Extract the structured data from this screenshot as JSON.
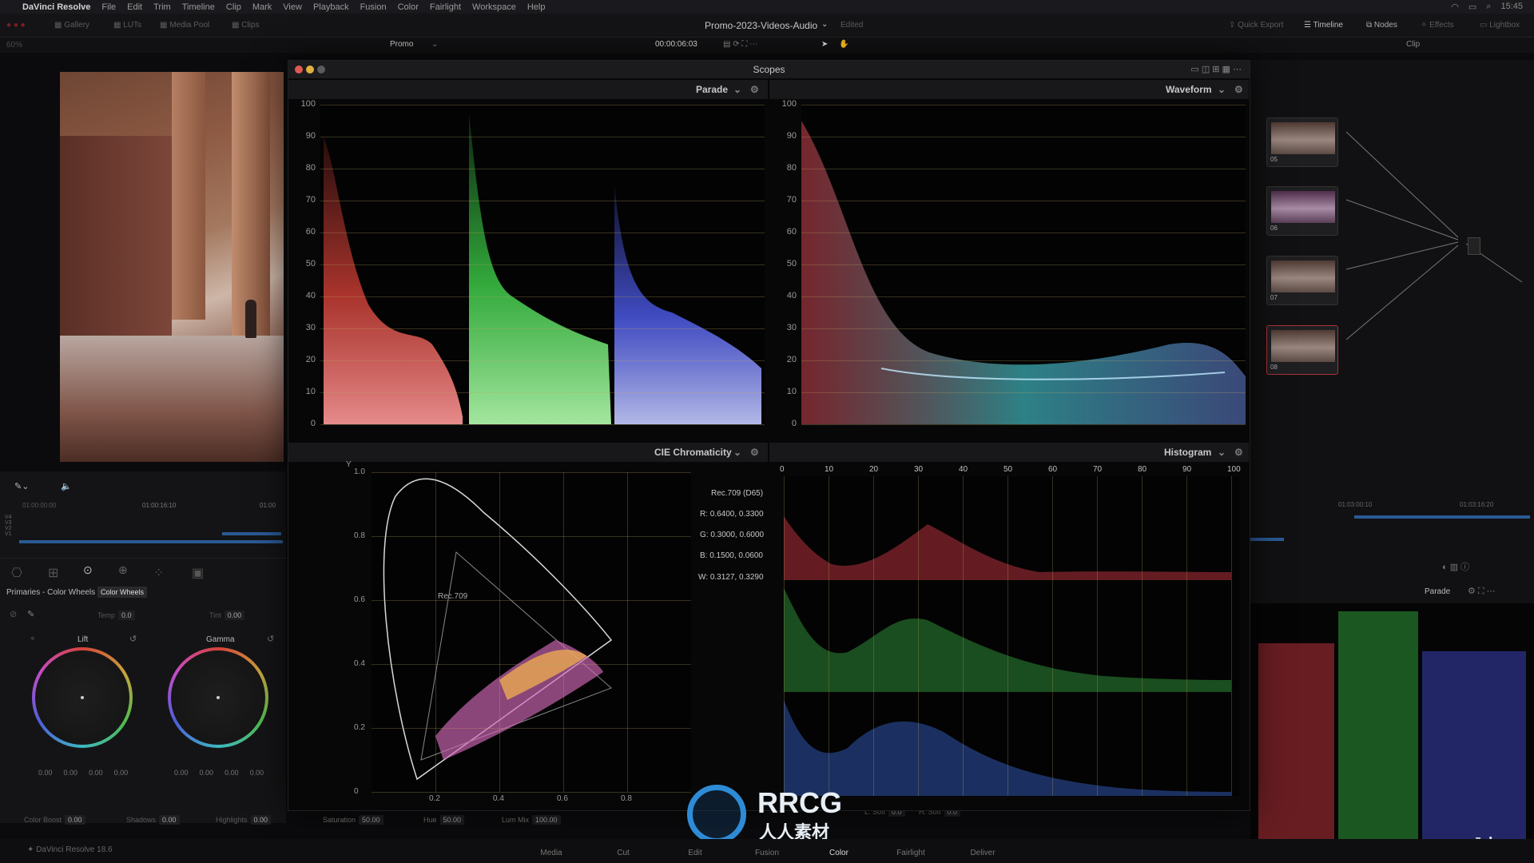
{
  "menubar": {
    "app": "DaVinci Resolve",
    "items": [
      "File",
      "Edit",
      "Trim",
      "Timeline",
      "Clip",
      "Mark",
      "View",
      "Playback",
      "Fusion",
      "Color",
      "Fairlight",
      "Workspace",
      "Help"
    ],
    "clock": "15:45"
  },
  "toolbar": {
    "gallery": "Gallery",
    "luts": "LUTs",
    "media_pool": "Media Pool",
    "clips": "Clips",
    "project_title": "Promo-2023-Videos-Audio",
    "edited": "Edited",
    "quick_export": "Quick Export",
    "timeline": "Timeline",
    "nodes": "Nodes",
    "effects": "Effects",
    "lightbox": "Lightbox",
    "zoom": "60%",
    "timeline_name": "Promo",
    "timecode": "00:00:06:03",
    "clip_mode": "Clip"
  },
  "scopes": {
    "title": "Scopes",
    "parade": {
      "label": "Parade",
      "ticks": [
        "100",
        "90",
        "80",
        "70",
        "60",
        "50",
        "40",
        "30",
        "20",
        "10",
        "0"
      ]
    },
    "waveform": {
      "label": "Waveform",
      "ticks": [
        "100",
        "90",
        "80",
        "70",
        "60",
        "50",
        "40",
        "30",
        "20",
        "10",
        "0"
      ]
    },
    "cie": {
      "label": "CIE Chromaticity",
      "y_label": "Y",
      "y_ticks": [
        "1.0",
        "0.8",
        "0.6",
        "0.4",
        "0.2",
        "0"
      ],
      "x_ticks": [
        "0.2",
        "0.4",
        "0.6",
        "0.8"
      ],
      "gamut_label": "Rec.709",
      "legend": [
        "Rec.709 (D65)",
        "R: 0.6400, 0.3300",
        "G: 0.3000, 0.6000",
        "B: 0.1500, 0.0600",
        "W: 0.3127, 0.3290"
      ]
    },
    "histogram": {
      "label": "Histogram",
      "x_ticks": [
        "0",
        "10",
        "20",
        "30",
        "40",
        "50",
        "60",
        "70",
        "80",
        "90",
        "100"
      ]
    }
  },
  "left_panel": {
    "timeline_tc": [
      "01:00:00:00",
      "01:00:16:10",
      "01:00"
    ],
    "tracks": [
      "V4",
      "V3",
      "V2",
      "V1"
    ],
    "primaries_title": "Primaries - Color Wheels",
    "tooltip": "Color Wheels",
    "temp_label": "Temp",
    "temp_value": "0.0",
    "tint_label": "Tint",
    "tint_value": "0.00",
    "lift": {
      "label": "Lift",
      "values": [
        "0.00",
        "0.00",
        "0.00",
        "0.00"
      ]
    },
    "gamma": {
      "label": "Gamma",
      "values": [
        "0.00",
        "0.00",
        "0.00",
        "0.00"
      ]
    }
  },
  "bottom_params": {
    "color_boost": {
      "label": "Color Boost",
      "value": "0.00"
    },
    "shadows": {
      "label": "Shadows",
      "value": "0.00"
    },
    "highlights": {
      "label": "Highlights",
      "value": "0.00"
    },
    "saturation": {
      "label": "Saturation",
      "value": "50.00"
    },
    "hue": {
      "label": "Hue",
      "value": "50.00"
    },
    "lum_mix": {
      "label": "Lum Mix",
      "value": "100.00"
    },
    "l_soft": {
      "label": "L. Soft",
      "value": "0.0"
    },
    "h_soft": {
      "label": "H. Soft",
      "value": "0.0"
    }
  },
  "nodes": [
    {
      "id": "05"
    },
    {
      "id": "06"
    },
    {
      "id": "07"
    },
    {
      "id": "08"
    }
  ],
  "right_panel": {
    "timeline_tc": [
      "01:03:00:10",
      "01:03:16:20"
    ],
    "scope_mode": "Parade"
  },
  "bottom_nav": {
    "version": "DaVinci Resolve 18.6",
    "items": [
      "Media",
      "Cut",
      "Edit",
      "Fusion",
      "Color",
      "Fairlight",
      "Deliver"
    ],
    "active": "Color"
  },
  "watermarks": {
    "rrcg": "RRCG",
    "rrcg_cn": "人人素材",
    "udemy": "ūdemy"
  },
  "colors": {
    "red": "#e0443a",
    "green": "#3fd34a",
    "blue": "#4f5df0",
    "cyan": "#3fb7bd"
  }
}
